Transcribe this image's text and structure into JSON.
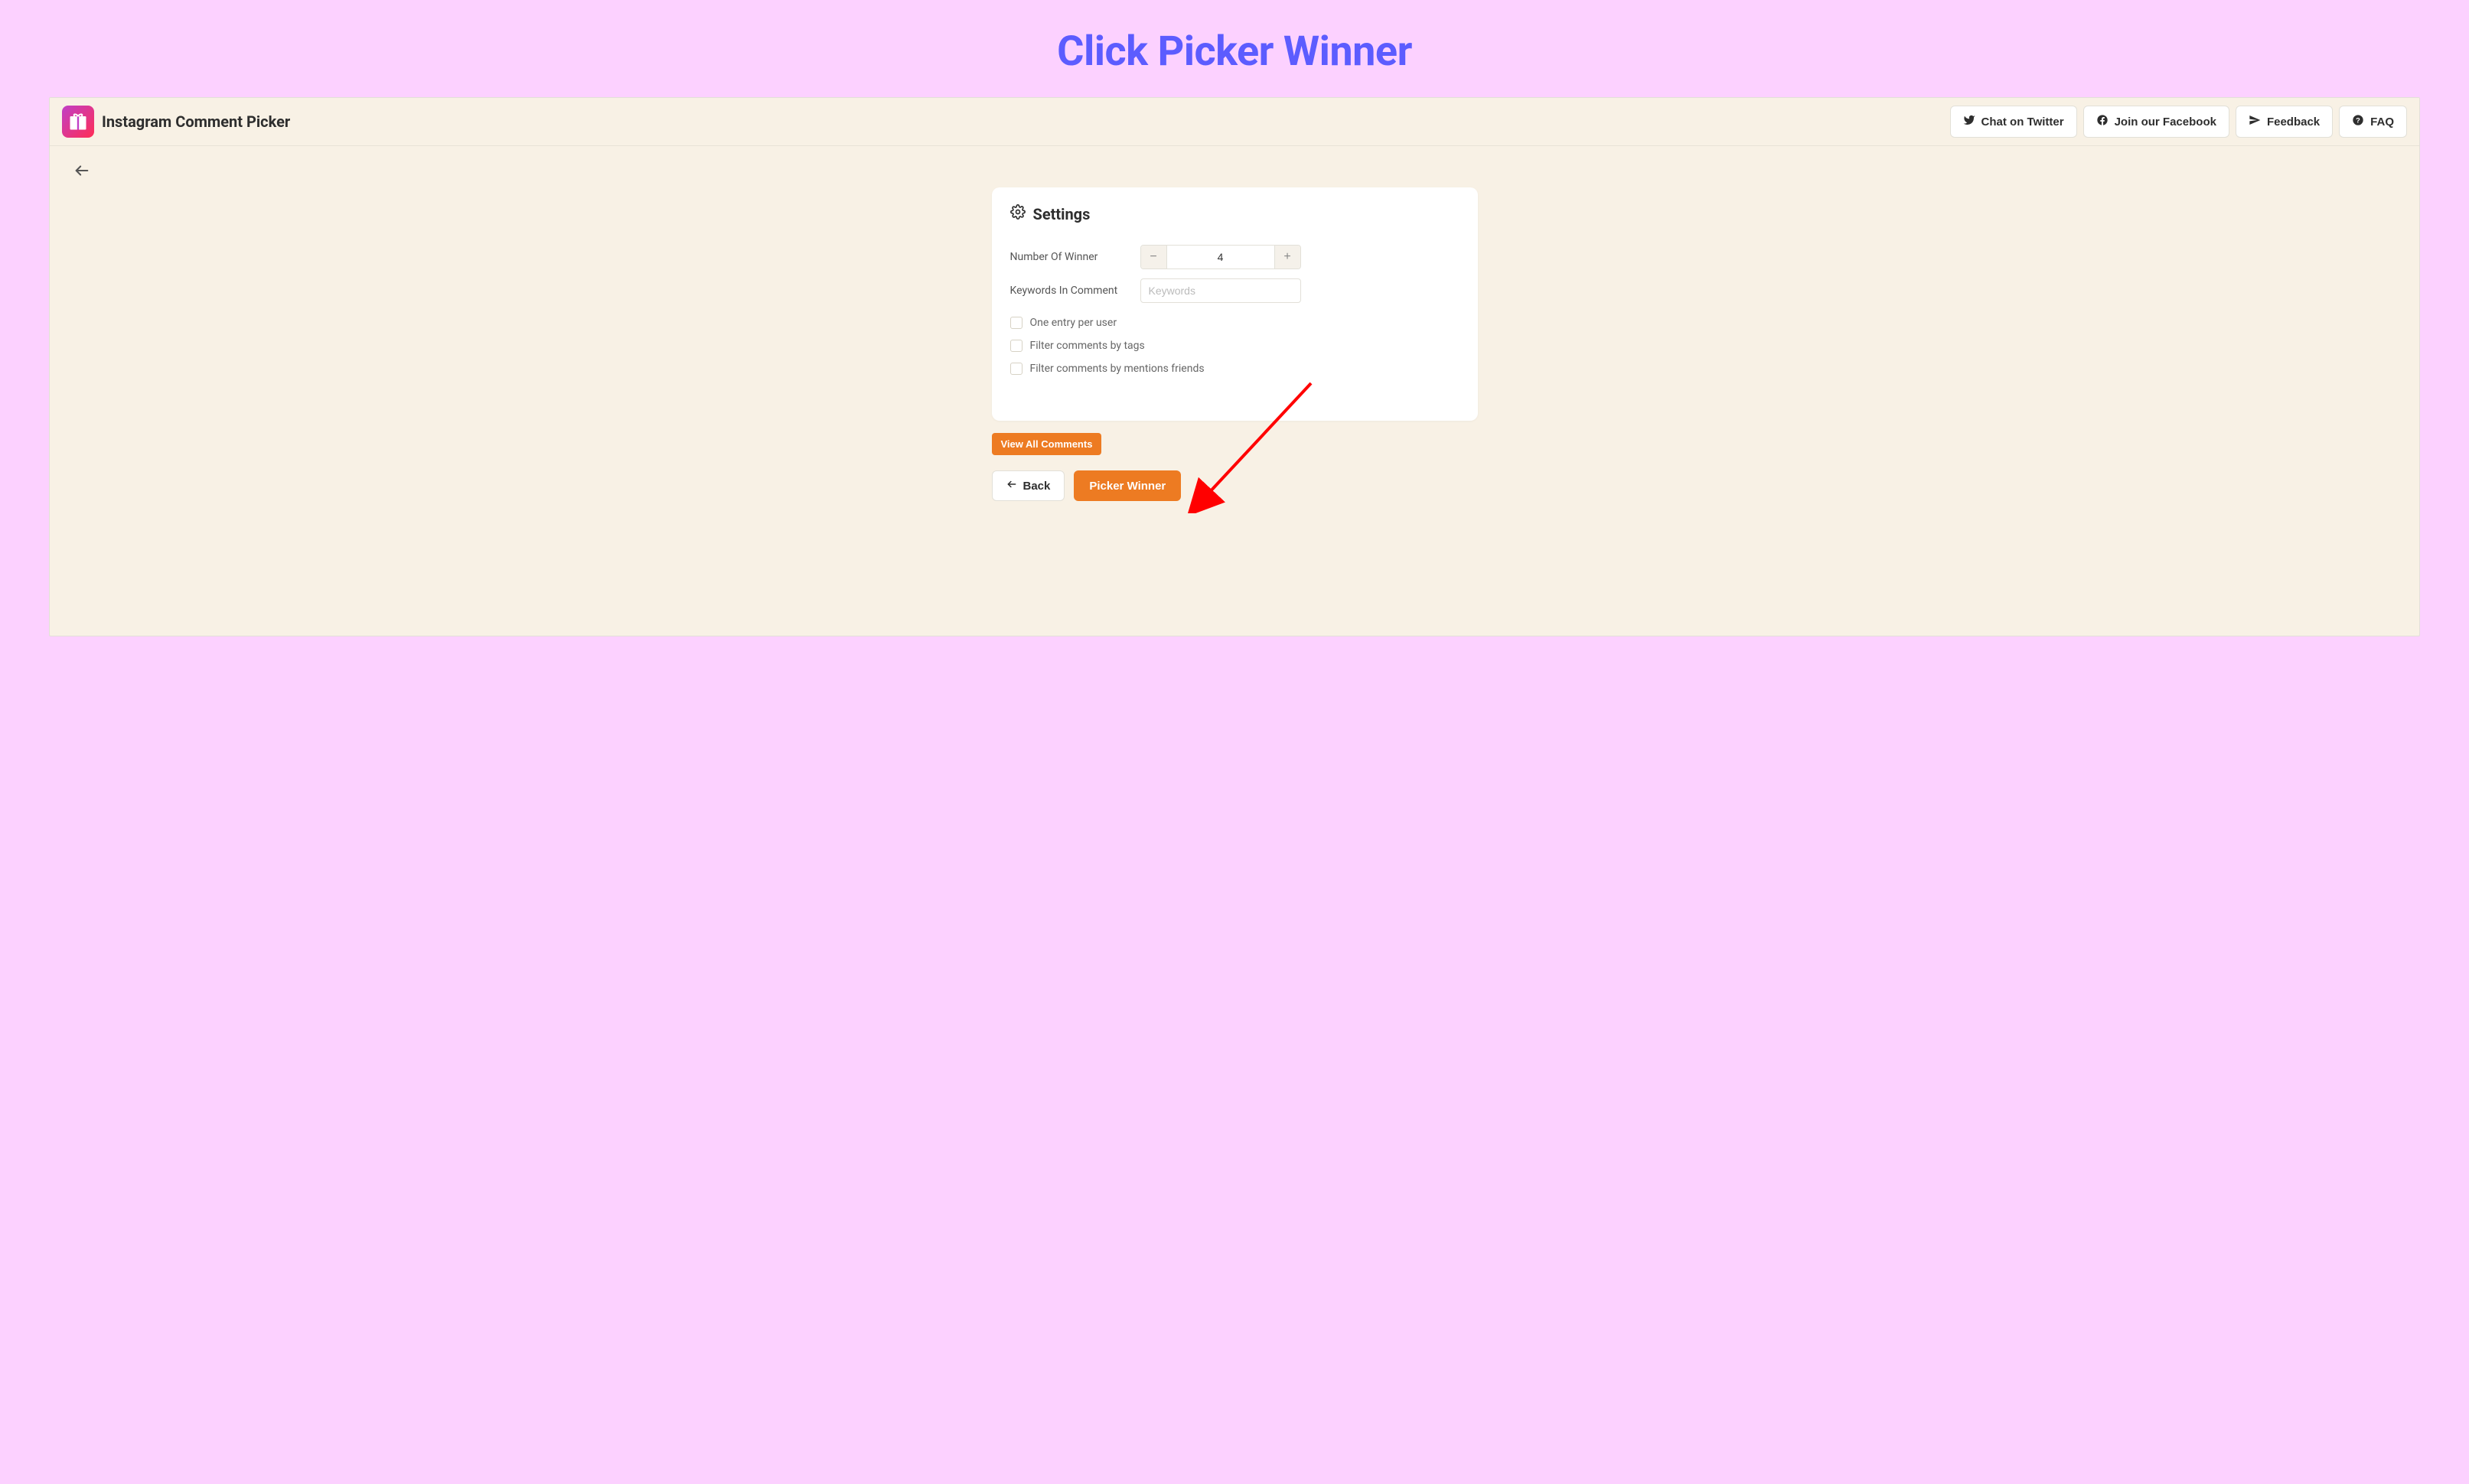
{
  "banner": {
    "title": "Click Picker Winner"
  },
  "header": {
    "app_title": "Instagram Comment Picker",
    "actions": {
      "twitter": "Chat on Twitter",
      "facebook": "Join our Facebook",
      "feedback": "Feedback",
      "faq": "FAQ"
    }
  },
  "settings": {
    "title": "Settings",
    "number_of_winner_label": "Number Of Winner",
    "number_of_winner_value": "4",
    "keywords_label": "Keywords In Comment",
    "keywords_placeholder": "Keywords",
    "keywords_value": "",
    "checkboxes": {
      "one_entry": "One entry per user",
      "filter_tags": "Filter comments by tags",
      "filter_mentions": "Filter comments by mentions friends"
    }
  },
  "buttons": {
    "view_all": "View All Comments",
    "back": "Back",
    "picker_winner": "Picker Winner"
  },
  "colors": {
    "page_bg": "#fcd1ff",
    "app_bg": "#f8f1e5",
    "accent_orange": "#ed7b22",
    "banner_blue": "#5c5cff",
    "annotation_red": "#ff0000"
  }
}
